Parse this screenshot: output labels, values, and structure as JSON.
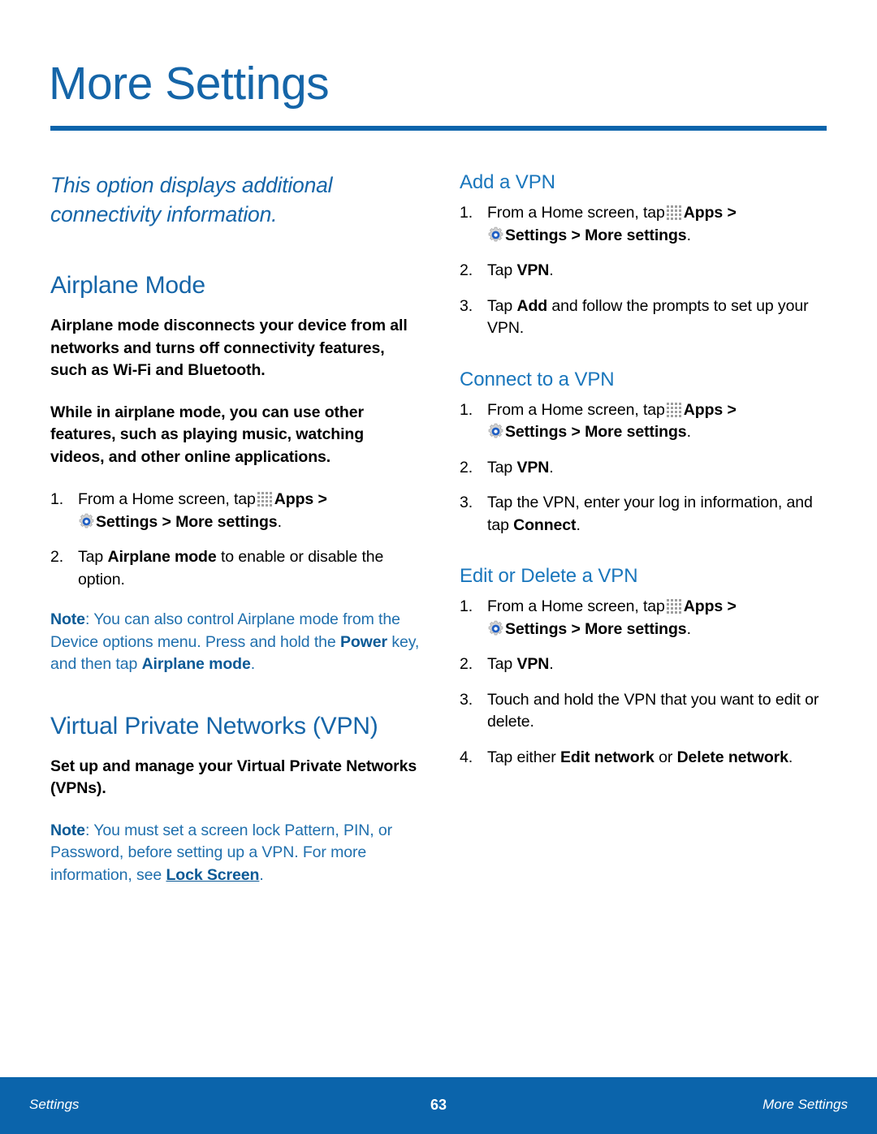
{
  "page": {
    "title": "More Settings",
    "accent_blue": "#1565a8",
    "rule_blue": "#0b64ab",
    "note_blue": "#1f6fad"
  },
  "left_column": {
    "intro": "This option displays additional connectivity information.",
    "airplane": {
      "heading": "Airplane Mode",
      "para1": "Airplane mode disconnects your device from all networks and turns off connectivity features, such as Wi-Fi and Bluetooth.",
      "para2": "While in airplane mode, you can use other features, such as playing music, watching videos, and other online applications.",
      "steps": [
        {
          "num": "1.",
          "pre": "From a Home screen, tap",
          "apps_label": "Apps",
          "sep1": ">",
          "settings_label": "Settings",
          "sep2": ">",
          "more_settings_label": "More settings",
          "post": "."
        },
        {
          "num": "2.",
          "pre": "Tap",
          "bold": "Airplane mode",
          "post": "to enable or disable the option."
        }
      ],
      "note_label": "Note",
      "note_text_a": ": You can also control Airplane mode from the Device options menu. Press and hold the ",
      "note_bold_power": "Power",
      "note_text_b": " key, and then tap ",
      "note_bold_airplane": "Airplane mode",
      "note_text_c": "."
    },
    "vpn": {
      "heading": "Virtual Private Networks (VPN)",
      "para1": "Set up and manage your Virtual Private Networks (VPNs).",
      "note_label": "Note",
      "note_text_a": ": You must set a screen lock Pattern, PIN, or Password, before setting up a VPN. For more information, see ",
      "note_link": "Lock Screen",
      "note_text_b": "."
    }
  },
  "right_column": {
    "add_vpn": {
      "heading": "Add a VPN",
      "steps": [
        {
          "num": "1.",
          "pre": "From a Home screen, tap",
          "apps_label": "Apps",
          "sep1": ">",
          "settings_label": "Settings",
          "sep2": ">",
          "more_settings_label": "More settings",
          "post": "."
        },
        {
          "num": "2.",
          "pre": "Tap",
          "bold": "VPN",
          "post": "."
        },
        {
          "num": "3.",
          "pre": "Tap",
          "bold": "Add",
          "post": "and follow the prompts to set up your VPN."
        }
      ]
    },
    "connect_vpn": {
      "heading": "Connect to a VPN",
      "steps": [
        {
          "num": "1.",
          "pre": "From a Home screen, tap",
          "apps_label": "Apps",
          "sep1": ">",
          "settings_label": "Settings",
          "sep2": ">",
          "more_settings_label": "More settings",
          "post": "."
        },
        {
          "num": "2.",
          "pre": "Tap",
          "bold": "VPN",
          "post": "."
        },
        {
          "num": "3.",
          "pre": "Tap the VPN, enter your log in information, and tap",
          "bold": "Connect",
          "post": "."
        }
      ]
    },
    "edit_delete_vpn": {
      "heading": "Edit or Delete a VPN",
      "steps": [
        {
          "num": "1.",
          "pre": "From a Home screen, tap",
          "apps_label": "Apps",
          "sep1": ">",
          "settings_label": "Settings",
          "sep2": ">",
          "more_settings_label": "More settings",
          "post": "."
        },
        {
          "num": "2.",
          "pre": "Tap",
          "bold": "VPN",
          "post": "."
        },
        {
          "num": "3.",
          "pre": "Touch and hold the VPN that you want to edit or delete.",
          "bold": "",
          "post": ""
        },
        {
          "num": "4.",
          "pre": "Tap either",
          "bold": "Edit network",
          "mid": "or",
          "bold2": "Delete network",
          "post": "."
        }
      ]
    }
  },
  "footer": {
    "left": "Settings",
    "center": "63",
    "right": "More Settings"
  },
  "icons": {
    "apps": "apps-grid-icon",
    "settings": "gear-icon"
  }
}
